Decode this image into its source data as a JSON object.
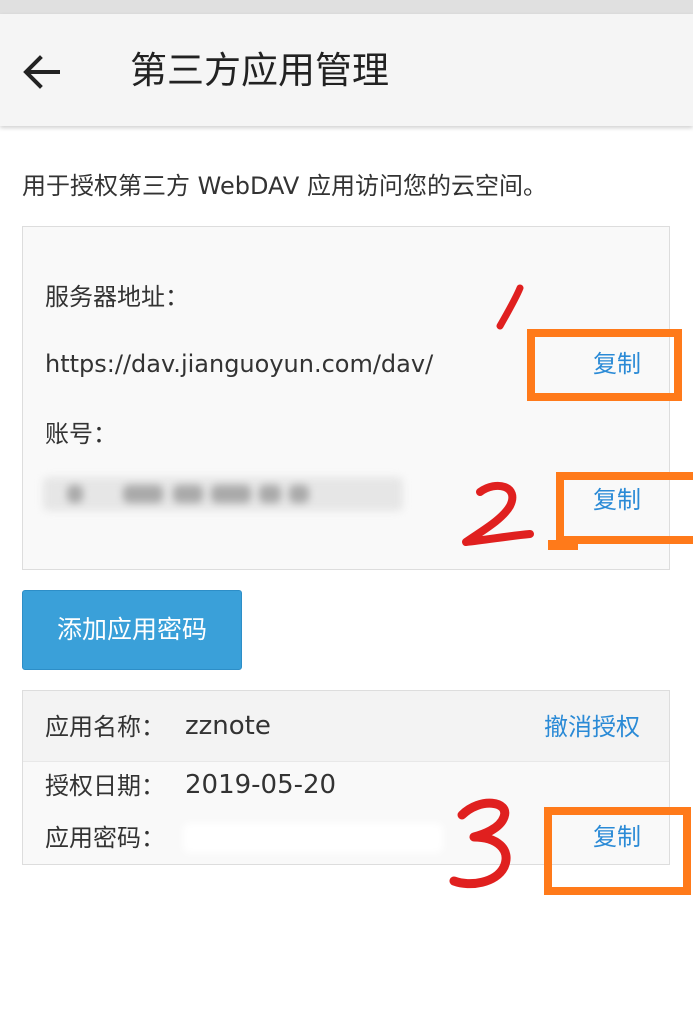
{
  "header": {
    "title": "第三方应用管理",
    "back_icon": "arrow-left-icon"
  },
  "intro_text": "用于授权第三方 WebDAV 应用访问您的云空间。",
  "server_panel": {
    "server_label": "服务器地址：",
    "server_url": "https://dav.jianguoyun.com/dav/",
    "copy_label": "复制",
    "account_label": "账号：",
    "account_value_hidden": true,
    "account_copy_label": "复制"
  },
  "add_button_label": "添加应用密码",
  "app_panel": {
    "name_label": "应用名称：",
    "name_value": "zznote",
    "revoke_label": "撤消授权",
    "date_label": "授权日期：",
    "date_value": "2019-05-20",
    "password_label": "应用密码：",
    "password_copy_label": "复制"
  },
  "annotations": {
    "box_color": "#ff7a1a",
    "number_color": "#e0201f",
    "numbers": [
      "1",
      "2",
      "3"
    ]
  },
  "colors": {
    "link": "#2a8ad6",
    "button": "#3aa0d9",
    "appbar": "#f5f5f5"
  }
}
